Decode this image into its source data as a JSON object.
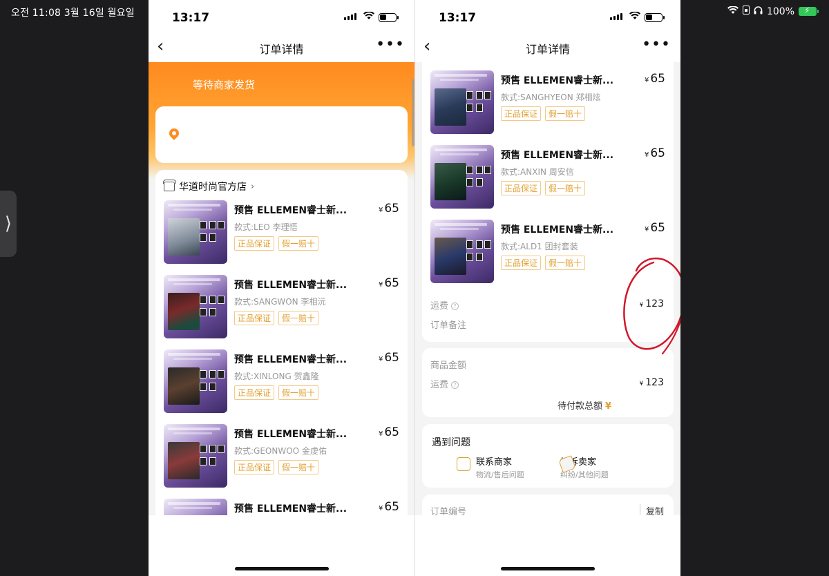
{
  "ipad": {
    "time_date": "오전 11:08   3월 16일 월요일",
    "battery": "100%"
  },
  "phone_time": "13:17",
  "nav": {
    "title": "订单详情"
  },
  "panel1": {
    "order_status": "等待商家发货",
    "shop_name": "华道时尚官方店",
    "items": [
      {
        "name": "预售 ELLEMEN睿士新...",
        "price": "65",
        "variant": "款式:LEO 李理悟",
        "tags": [
          "正品保证",
          "假一赔十"
        ]
      },
      {
        "name": "预售 ELLEMEN睿士新...",
        "price": "65",
        "variant": "款式:SANGWON 李相沅",
        "tags": [
          "正品保证",
          "假一赔十"
        ]
      },
      {
        "name": "预售 ELLEMEN睿士新...",
        "price": "65",
        "variant": "款式:XINLONG 贺鑫隆",
        "tags": [
          "正品保证",
          "假一赔十"
        ]
      },
      {
        "name": "预售 ELLEMEN睿士新...",
        "price": "65",
        "variant": "款式:GEONWOO 金虔佑",
        "tags": [
          "正品保证",
          "假一赔十"
        ]
      },
      {
        "name": "预售 ELLEMEN睿士新...",
        "price": "65"
      }
    ]
  },
  "panel2": {
    "items": [
      {
        "name": "预售 ELLEMEN睿士新...",
        "price": "65",
        "variant": "款式:SANGHYEON 郑相炫",
        "tags": [
          "正品保证",
          "假一赔十"
        ]
      },
      {
        "name": "预售 ELLEMEN睿士新...",
        "price": "65",
        "variant": "款式:ANXIN 周安信",
        "tags": [
          "正品保证",
          "假一赔十"
        ]
      },
      {
        "name": "预售 ELLEMEN睿士新...",
        "price": "65",
        "variant": "款式:ALD1 团封套装",
        "tags": [
          "正品保证",
          "假一赔十"
        ]
      }
    ],
    "shipping_label": "运费",
    "shipping_value": "123",
    "remark_label": "订单备注",
    "goods_amount_label": "商品金额",
    "total_label": "待付款总额",
    "total_currency": "¥",
    "issue": {
      "title": "遇到问题",
      "contact": {
        "label": "联系商家",
        "sub": "物流/售后问题"
      },
      "complain": {
        "label": "投诉卖家",
        "sub": "纠纷/其他问题"
      }
    },
    "order_no_label": "订单编号",
    "copy_label": "复制"
  },
  "currency": "¥",
  "colors": {
    "orange": "#ff8a1f",
    "tag": "#e0a030",
    "annotation": "#d0182b",
    "battery": "#34c759"
  }
}
